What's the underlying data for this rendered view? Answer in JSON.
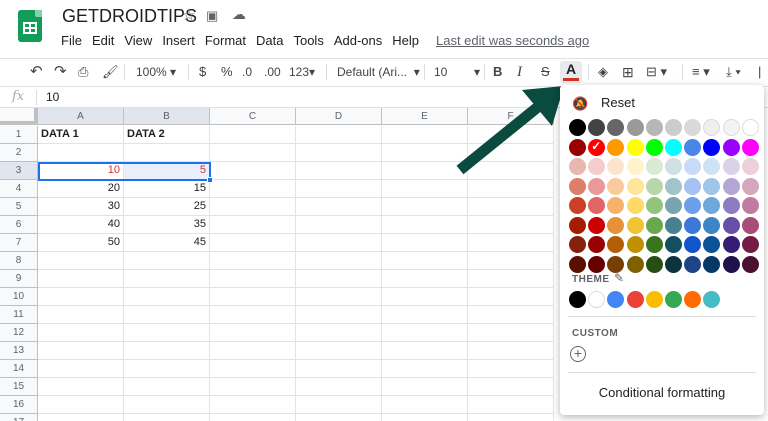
{
  "app": {
    "doc_title": "GETDROIDTIPS",
    "last_edit": "Last edit was seconds ago"
  },
  "menu": [
    "File",
    "Edit",
    "View",
    "Insert",
    "Format",
    "Data",
    "Tools",
    "Add-ons",
    "Help"
  ],
  "toolbar": {
    "zoom": "100%",
    "currency": "$",
    "percent": "%",
    "dec_decrease": ".0",
    "dec_increase": ".00",
    "more_formats": "123",
    "font": "Default (Ari...",
    "font_size": "10",
    "bold": "B",
    "italic": "I",
    "strike": "S",
    "font_color": "A"
  },
  "formula_bar": {
    "fx": "fx",
    "value": "10"
  },
  "columns": [
    "A",
    "B",
    "C",
    "D",
    "E",
    "F"
  ],
  "rows": [
    "1",
    "2",
    "3",
    "4",
    "5",
    "6",
    "7",
    "8",
    "9",
    "10",
    "11",
    "12",
    "13",
    "14",
    "15",
    "16",
    "17"
  ],
  "cells": {
    "A1": "DATA 1",
    "B1": "DATA 2",
    "A3": "10",
    "B3": "5",
    "A4": "20",
    "B4": "15",
    "A5": "30",
    "B5": "25",
    "A6": "40",
    "B6": "35",
    "A7": "50",
    "B7": "45"
  },
  "palette": {
    "reset_label": "Reset",
    "theme_label": "THEME",
    "custom_label": "CUSTOM",
    "conditional_label": "Conditional formatting",
    "standard_colors": [
      [
        "#000000",
        "#434343",
        "#666666",
        "#999999",
        "#b7b7b7",
        "#cccccc",
        "#d9d9d9",
        "#efefef",
        "#f3f3f3",
        "#ffffff"
      ],
      [
        "#980000",
        "#ff0000",
        "#ff9900",
        "#ffff00",
        "#00ff00",
        "#00ffff",
        "#4a86e8",
        "#0000ff",
        "#9900ff",
        "#ff00ff"
      ],
      [
        "#e6b8af",
        "#f4cccc",
        "#fce5cd",
        "#fff2cc",
        "#d9ead3",
        "#d0e0e3",
        "#c9daf8",
        "#cfe2f3",
        "#d9d2e9",
        "#ead1dc"
      ],
      [
        "#dd7e6b",
        "#ea9999",
        "#f9cb9c",
        "#ffe599",
        "#b6d7a8",
        "#a2c4c9",
        "#a4c2f4",
        "#9fc5e8",
        "#b4a7d6",
        "#d5a6bd"
      ],
      [
        "#cc4125",
        "#e06666",
        "#f6b26b",
        "#ffd966",
        "#93c47d",
        "#76a5af",
        "#6d9eeb",
        "#6fa8dc",
        "#8e7cc3",
        "#c27ba0"
      ],
      [
        "#a61c00",
        "#cc0000",
        "#e69138",
        "#f1c232",
        "#6aa84f",
        "#45818e",
        "#3c78d8",
        "#3d85c6",
        "#674ea7",
        "#a64d79"
      ],
      [
        "#85200c",
        "#990000",
        "#b45f06",
        "#bf9000",
        "#38761d",
        "#134f5c",
        "#1155cc",
        "#0b5394",
        "#351c75",
        "#741b47"
      ],
      [
        "#5b0f00",
        "#660000",
        "#783f04",
        "#7f6000",
        "#274e13",
        "#0c343d",
        "#1c4587",
        "#073763",
        "#20124d",
        "#4c1130"
      ]
    ],
    "selected_color": "#ff0000",
    "theme_colors": [
      "#000000",
      "#ffffff",
      "#4285f4",
      "#ea4335",
      "#fbbc04",
      "#34a853",
      "#ff6d01",
      "#46bdc6"
    ]
  },
  "colors": {
    "sheets_green": "#0f9d58",
    "selection_blue": "#1a73e8",
    "arrow": "#0b4a3f",
    "red_text": "#d93025"
  }
}
